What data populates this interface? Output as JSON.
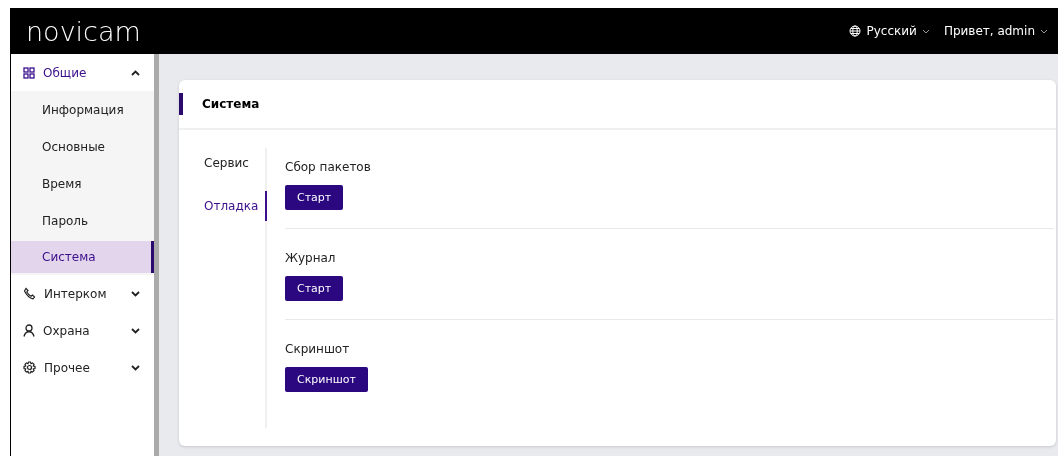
{
  "header": {
    "logo": "novicam",
    "language": "Русский",
    "user": "Привет, admin"
  },
  "sidebar": {
    "groups": [
      {
        "label": "Общие",
        "expanded": true,
        "children": [
          {
            "label": "Информация",
            "selected": false
          },
          {
            "label": "Основные",
            "selected": false
          },
          {
            "label": "Время",
            "selected": false
          },
          {
            "label": "Пароль",
            "selected": false
          },
          {
            "label": "Система",
            "selected": true
          }
        ]
      },
      {
        "label": "Интерком",
        "expanded": false
      },
      {
        "label": "Охрана",
        "expanded": false
      },
      {
        "label": "Прочее",
        "expanded": false
      }
    ]
  },
  "card": {
    "title": "Система",
    "tabs": [
      {
        "label": "Сервис",
        "selected": false
      },
      {
        "label": "Отладка",
        "selected": true
      }
    ],
    "sections": [
      {
        "title": "Сбор пакетов",
        "button": "Старт"
      },
      {
        "title": "Журнал",
        "button": "Старт"
      },
      {
        "title": "Скриншот",
        "button": "Скриншот"
      }
    ]
  }
}
